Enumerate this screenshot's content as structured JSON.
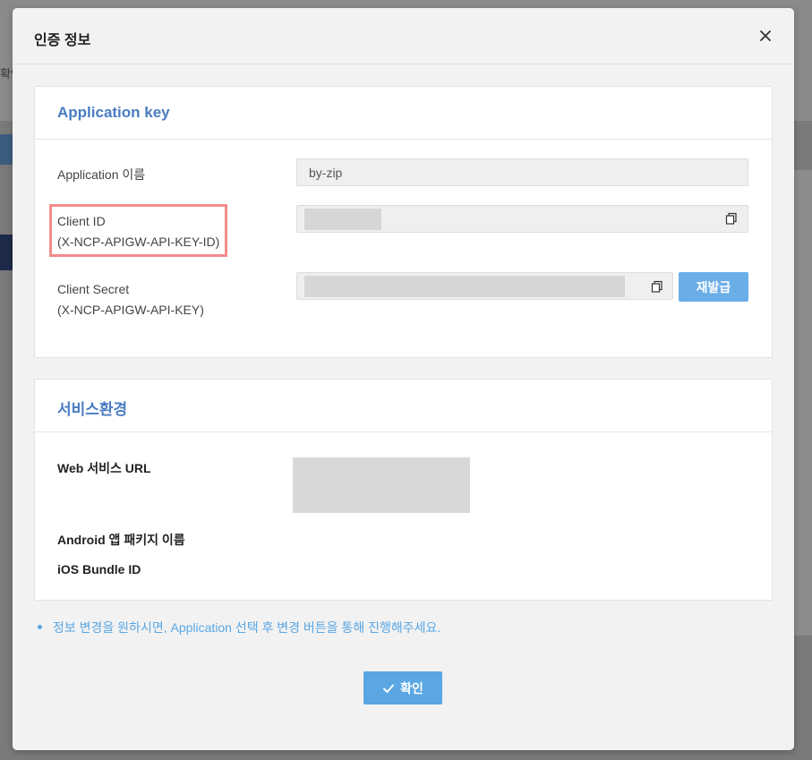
{
  "background": {
    "partial_text": "확인"
  },
  "modal": {
    "title": "인증 정보",
    "close_icon": "close-icon"
  },
  "app_key_section": {
    "title": "Application key",
    "app_name_label": "Application 이름",
    "app_name_value": "by-zip",
    "client_id_label_line1": "Client ID",
    "client_id_label_line2": "(X-NCP-APIGW-API-KEY-ID)",
    "client_secret_label_line1": "Client Secret",
    "client_secret_label_line2": "(X-NCP-APIGW-API-KEY)",
    "reissue_label": "재발급"
  },
  "service_section": {
    "title": "서비스환경",
    "web_url_label": "Web 서비스 URL",
    "android_label": "Android 앱 패키지 이름",
    "ios_label": "iOS Bundle ID"
  },
  "note": "정보 변경을 원하시면, Application 선택 후 변경 버튼을 통해 진행해주세요.",
  "confirm_label": "확인",
  "colors": {
    "accent": "#5aa7e4",
    "title_blue": "#4a7cc2",
    "highlight": "#f28b8b"
  }
}
